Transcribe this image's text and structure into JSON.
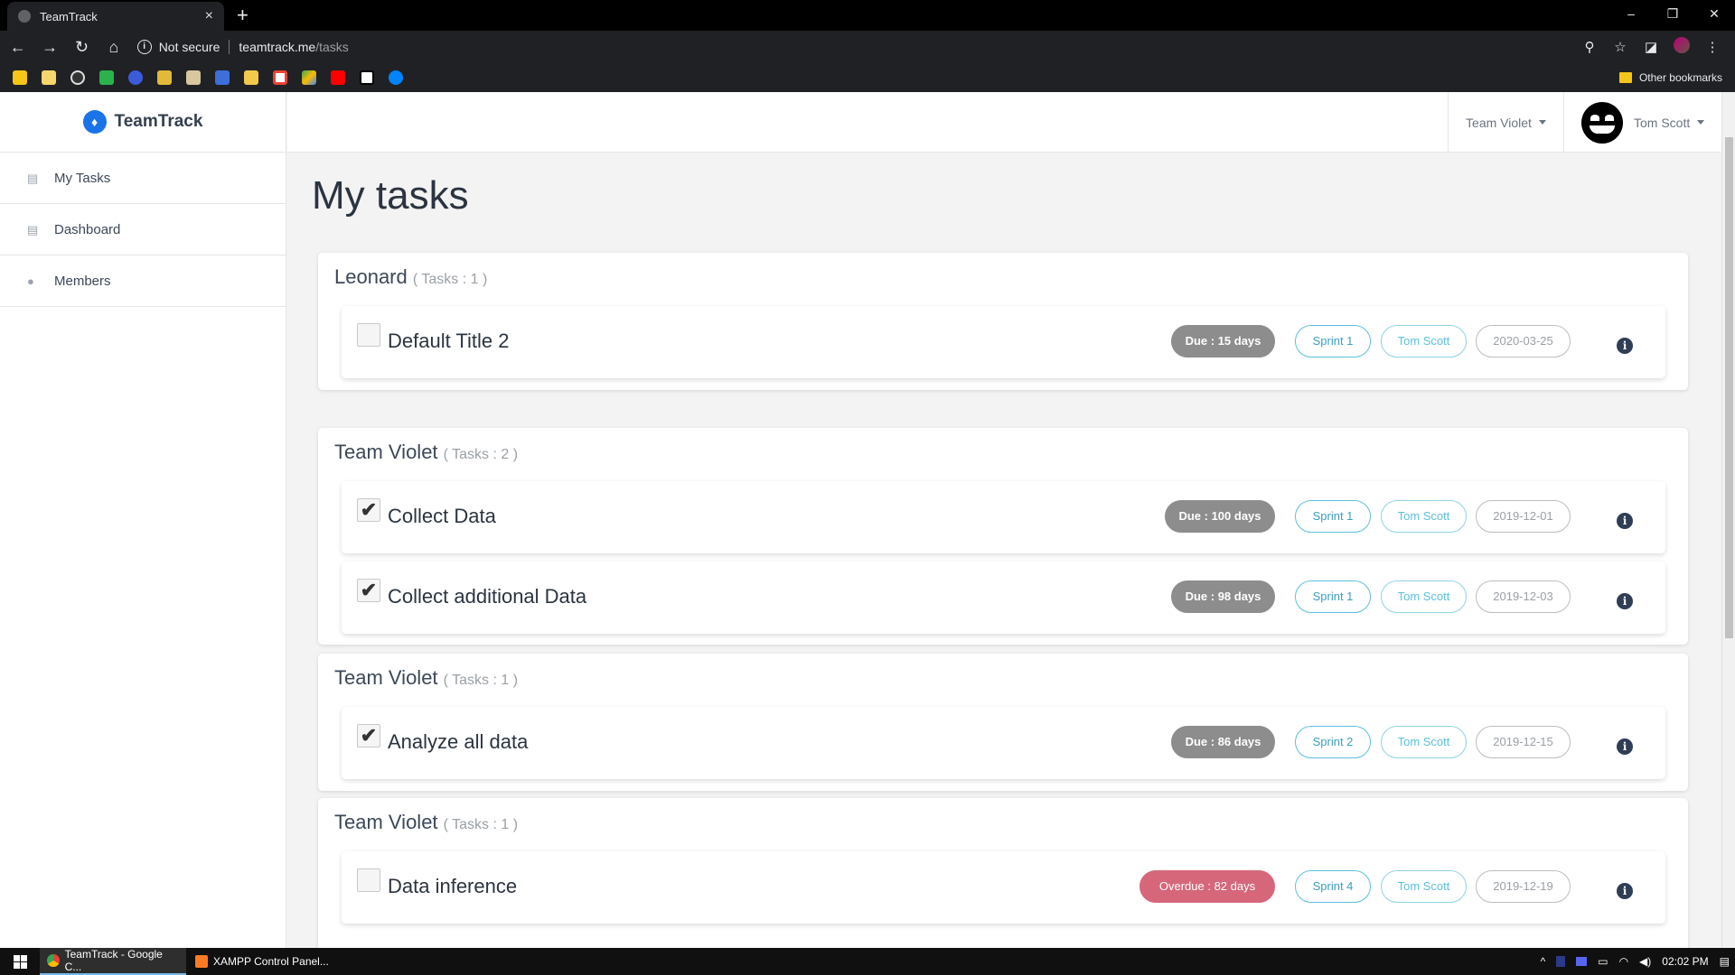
{
  "browser": {
    "tab_title": "TeamTrack",
    "tab_close": "×",
    "new_tab": "+",
    "security": "Not secure",
    "url_host": "teamtrack.me",
    "url_path": "/tasks",
    "bookmarks_other": "Other bookmarks",
    "window_controls": [
      "–",
      "❐",
      "✕"
    ]
  },
  "sidebar": {
    "brand": "TeamTrack",
    "items": [
      {
        "label": "My Tasks",
        "icon": "list-icon"
      },
      {
        "label": "Dashboard",
        "icon": "list-icon"
      },
      {
        "label": "Members",
        "icon": "user-icon"
      }
    ]
  },
  "topnav": {
    "team": "Team Violet",
    "user": "Tom Scott"
  },
  "page": {
    "title": "My tasks"
  },
  "groups": [
    {
      "name": "Leonard",
      "count": "( Tasks : 1 )",
      "tasks": [
        {
          "title": "Default Title 2",
          "checked": false,
          "due": "Due : 15 days",
          "due_status": "due",
          "sprint": "Sprint 1",
          "owner": "Tom Scott",
          "date": "2020-03-25"
        }
      ]
    },
    {
      "name": "Team Violet",
      "count": "( Tasks : 2 )",
      "tasks": [
        {
          "title": "Collect Data",
          "checked": true,
          "due": "Due : 100 days",
          "due_status": "due",
          "sprint": "Sprint 1",
          "owner": "Tom Scott",
          "date": "2019-12-01"
        },
        {
          "title": "Collect additional Data",
          "checked": true,
          "due": "Due : 98 days",
          "due_status": "due",
          "sprint": "Sprint 1",
          "owner": "Tom Scott",
          "date": "2019-12-03"
        }
      ]
    },
    {
      "name": "Team Violet",
      "count": "( Tasks : 1 )",
      "tasks": [
        {
          "title": "Analyze all data",
          "checked": true,
          "due": "Due : 86 days",
          "due_status": "due",
          "sprint": "Sprint 2",
          "owner": "Tom Scott",
          "date": "2019-12-15"
        }
      ]
    },
    {
      "name": "Team Violet",
      "count": "( Tasks : 1 )",
      "tasks": [
        {
          "title": "Data inference",
          "checked": false,
          "due": "Overdue : 82 days",
          "due_status": "overdue",
          "sprint": "Sprint 4",
          "owner": "Tom Scott",
          "date": "2019-12-19"
        }
      ]
    }
  ],
  "taskbar": {
    "apps": [
      "TeamTrack - Google C...",
      "XAMPP Control Panel..."
    ],
    "clock": "02:02 PM"
  },
  "colors": {
    "due": "#8d8d8d",
    "overdue": "#d6677b",
    "sprint": "#5bc0de",
    "brand": "#1a73e8"
  }
}
